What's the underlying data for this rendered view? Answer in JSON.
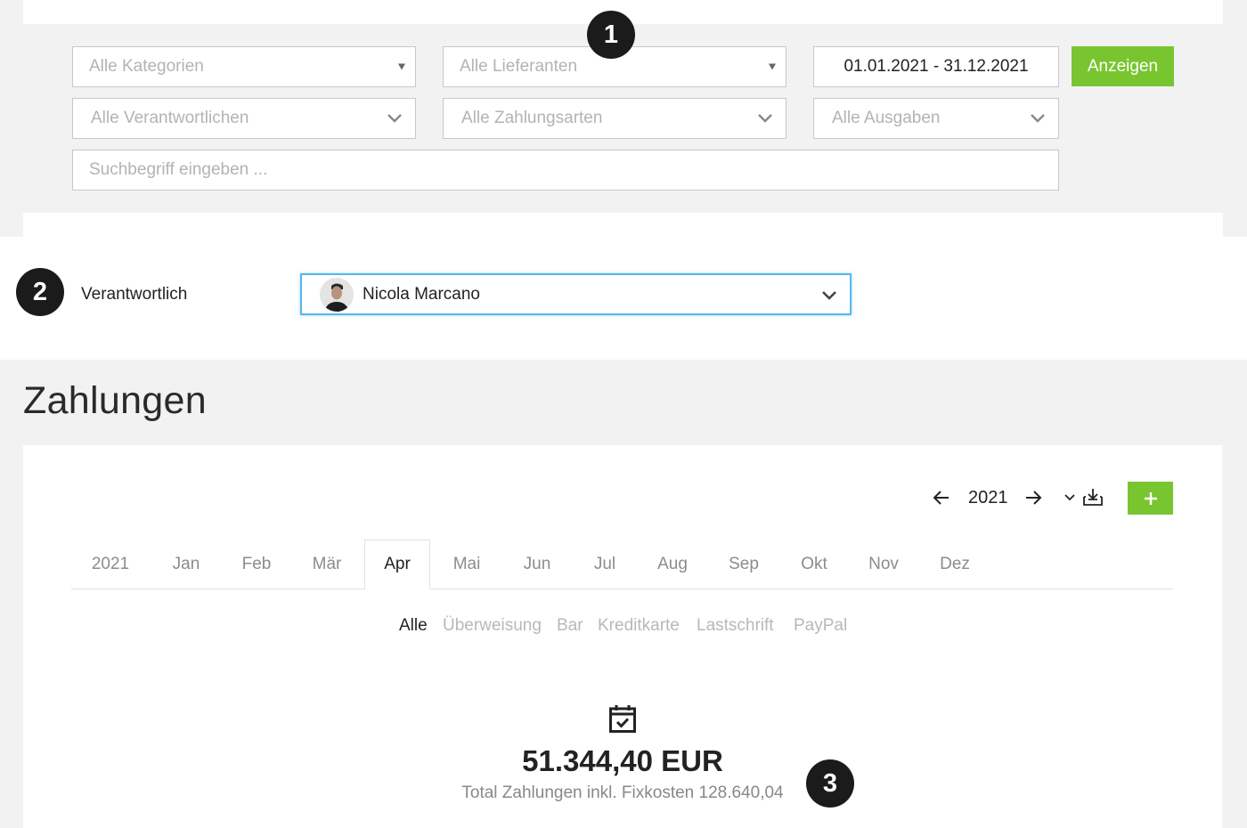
{
  "filters": {
    "category_placeholder": "Alle Kategorien",
    "supplier_placeholder": "Alle Lieferanten",
    "date_range": "01.01.2021 - 31.12.2021",
    "show_button": "Anzeigen",
    "responsible_placeholder": "Alle Verantwortlichen",
    "payment_type_placeholder": "Alle Zahlungsarten",
    "expenses_placeholder": "Alle Ausgaben",
    "search_placeholder": "Suchbegriff eingeben ..."
  },
  "markers": [
    "1",
    "2",
    "3"
  ],
  "responsible": {
    "label": "Verantwortlich",
    "selected_name": "Nicola Marcano"
  },
  "payments": {
    "heading": "Zahlungen",
    "year": "2021",
    "add_button": "+",
    "tabs": [
      "2021",
      "Jan",
      "Feb",
      "Mär",
      "Apr",
      "Mai",
      "Jun",
      "Jul",
      "Aug",
      "Sep",
      "Okt",
      "Nov",
      "Dez"
    ],
    "active_tab": "Apr",
    "payment_types": [
      "Alle",
      "Überweisung",
      "Bar",
      "Kreditkarte",
      "Lastschrift",
      "PayPal"
    ],
    "active_payment_type": "Alle",
    "total_value": "51.344,40 EUR",
    "total_caption": "Total Zahlungen inkl. Fixkosten 128.640,04"
  },
  "colors": {
    "accent_green": "#79c530",
    "focus_blue": "#55b7ee",
    "marker_dark": "#1b1b1b"
  }
}
